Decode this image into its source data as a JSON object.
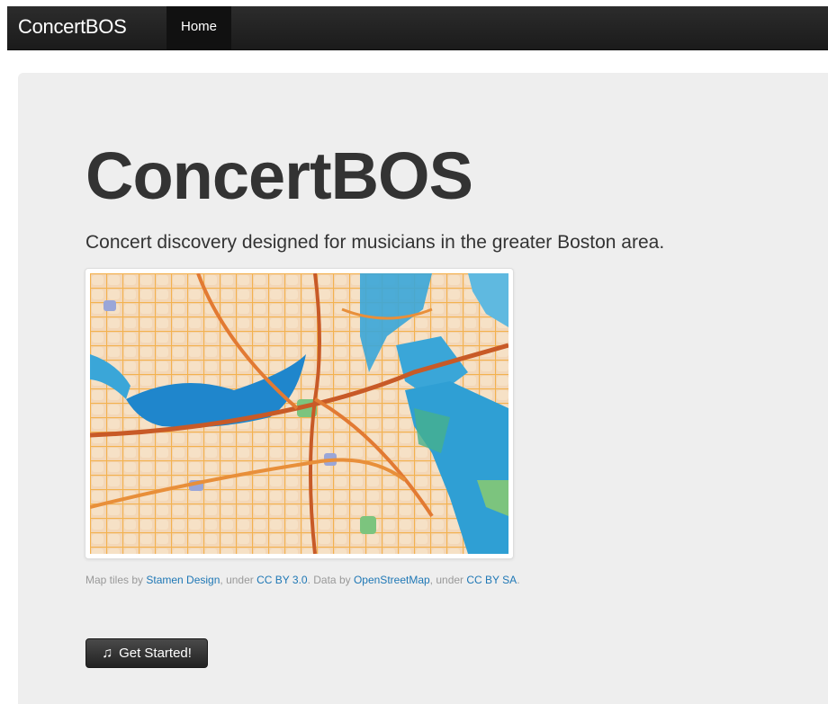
{
  "navbar": {
    "brand": "ConcertBOS",
    "home_label": "Home"
  },
  "hero": {
    "title": "ConcertBOS",
    "lead": "Concert discovery designed for musicians in the greater Boston area.",
    "map_icon": "watercolor-map-of-boston"
  },
  "credit": {
    "t1": "Map tiles by ",
    "link1": "Stamen Design",
    "t2": ", under ",
    "link2": "CC BY 3.0",
    "t3": ". Data by ",
    "link3": "OpenStreetMap",
    "t4": ", under ",
    "link4": "CC BY SA",
    "t5": "."
  },
  "cta": {
    "icon": "music-note-icon",
    "glyph": "♫",
    "label": "Get Started!"
  },
  "colors": {
    "navbar": "#222222",
    "hero_bg": "#eeeeee",
    "link": "#1e77b5",
    "water": "#3aa6d8",
    "road": "#f0a43a"
  }
}
